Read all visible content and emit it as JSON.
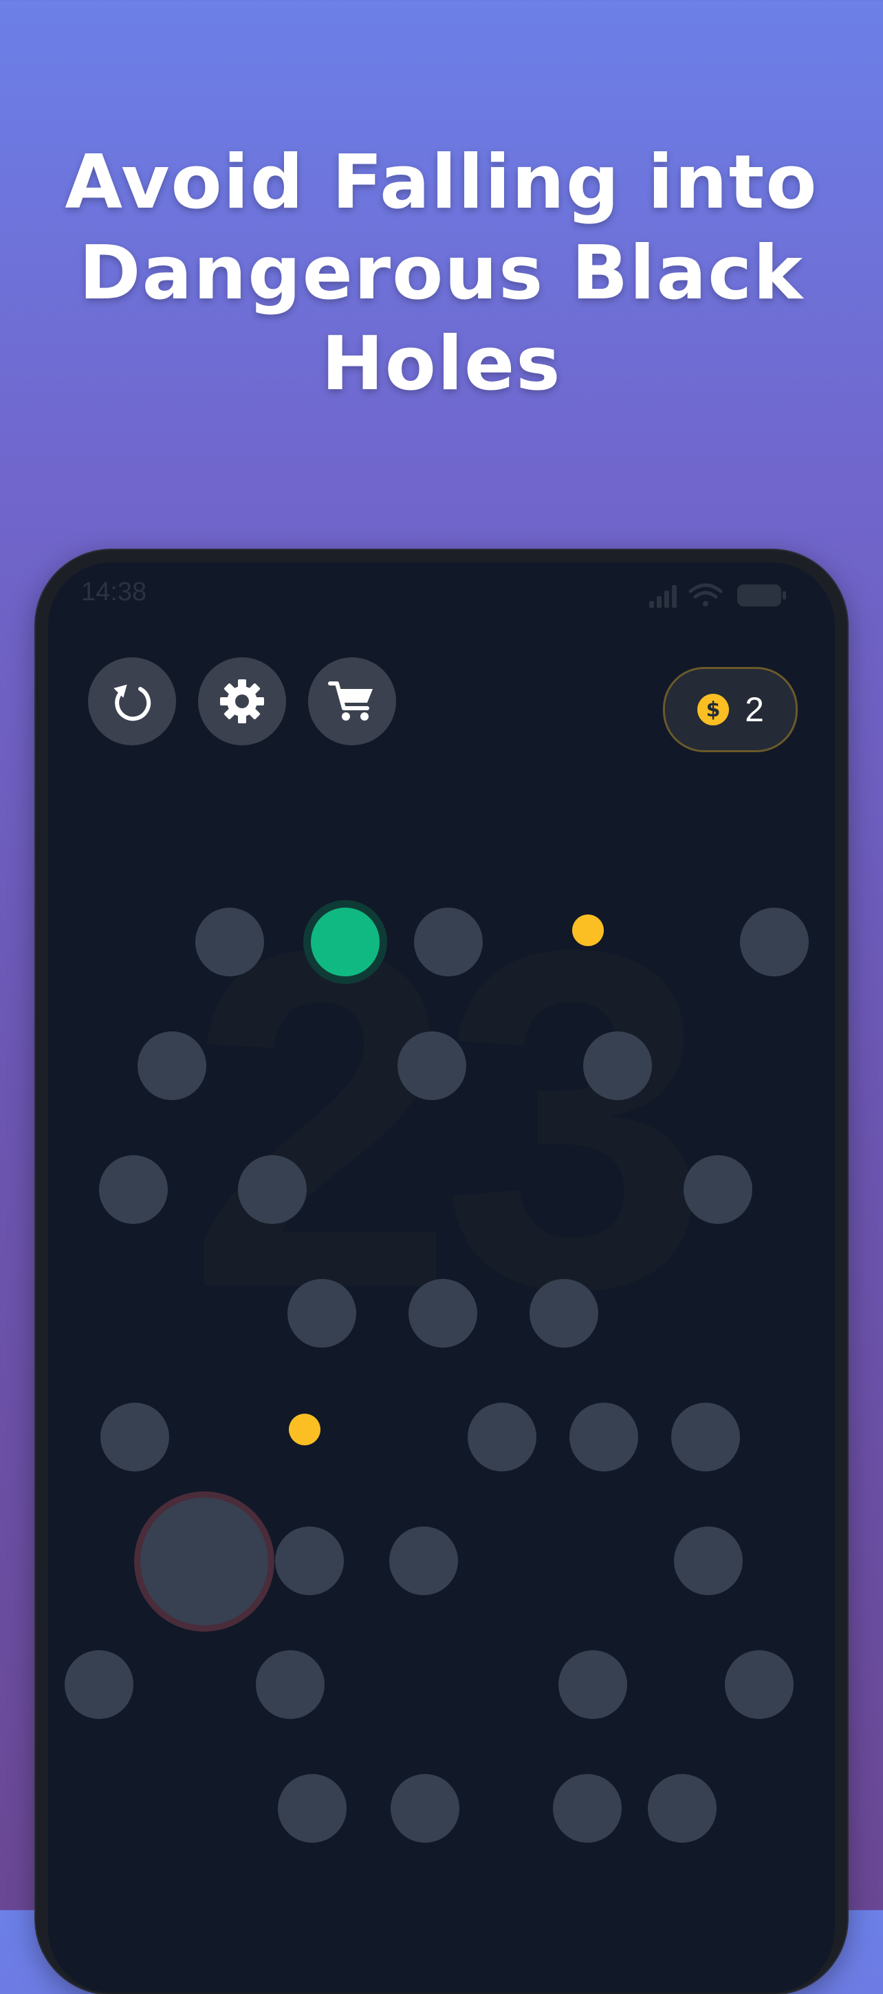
{
  "headline": {
    "line1": "Avoid Falling into",
    "line2": "Dangerous Black",
    "line3": "Holes"
  },
  "status_bar": {
    "time": "14:38",
    "icons": [
      "signal-icon",
      "wifi-icon",
      "battery-icon"
    ]
  },
  "controls": {
    "restart": "restart-icon",
    "settings": "gear-icon",
    "shop": "cart-icon"
  },
  "coins": {
    "icon": "dollar-coin-icon",
    "count": "2"
  },
  "score": "23",
  "colors": {
    "background_top": "#6c80e8",
    "background_bottom": "#6a4794",
    "screen": "#111827",
    "platform": "#374151",
    "player": "#10b981",
    "coin": "#fbbf24",
    "hole_ring": "#4a2c3a"
  }
}
